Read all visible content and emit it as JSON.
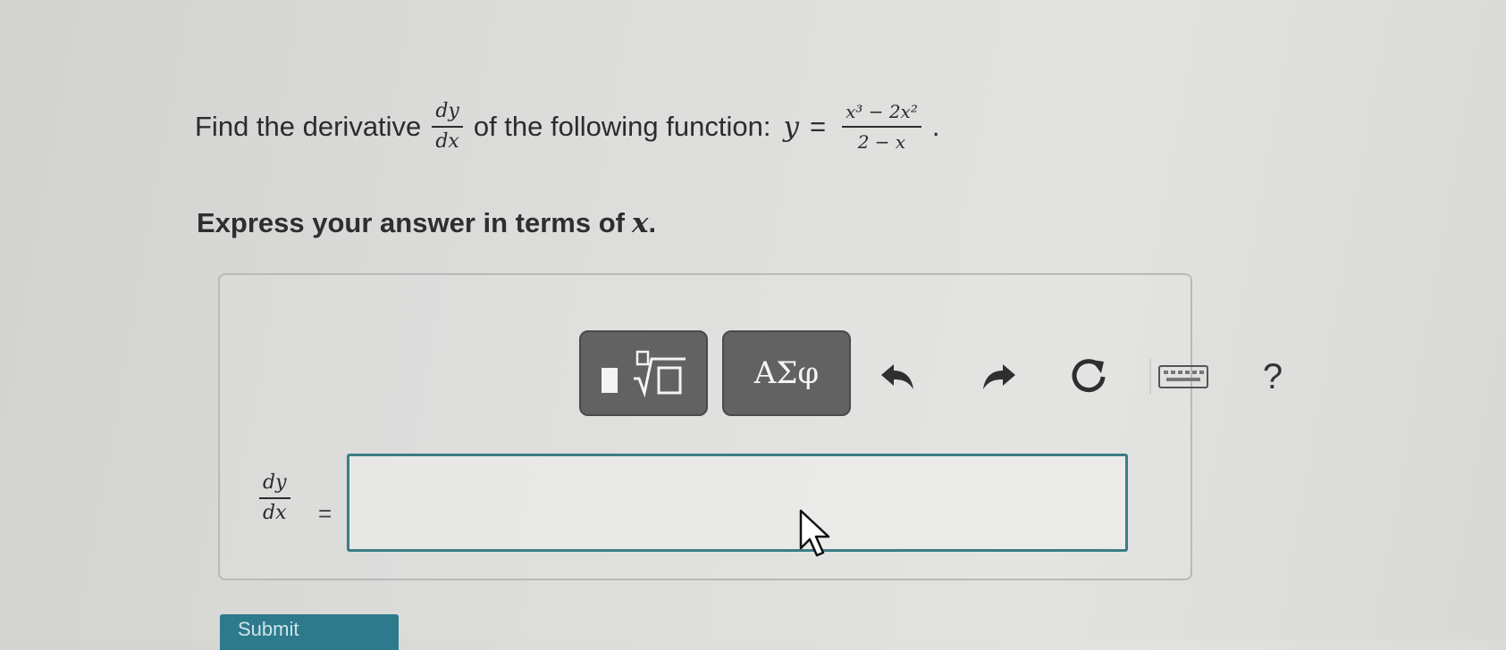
{
  "question": {
    "prefix": "Find the derivative",
    "derivative_num": "dy",
    "derivative_den": "dx",
    "middle": "of the following function:",
    "lhs_var": "y",
    "equals": "=",
    "func_num": "x³ − 2x²",
    "func_den": "2 − x",
    "period": "."
  },
  "instruction": {
    "text": "Express your answer in terms of",
    "var": "x",
    "period": "."
  },
  "toolbar": {
    "greek_label": "ΑΣφ",
    "undo_icon": "undo-icon",
    "redo_icon": "redo-icon",
    "reset_icon": "reset-icon",
    "keyboard_icon": "keyboard-icon",
    "help_label": "?"
  },
  "answer": {
    "lhs_num": "dy",
    "lhs_den": "dx",
    "equals": "=",
    "value": ""
  },
  "colors": {
    "input_border": "#3b7d86",
    "palette_button": "#626262",
    "submit": "#2d7a8c"
  },
  "submit": {
    "label": "Submit"
  }
}
